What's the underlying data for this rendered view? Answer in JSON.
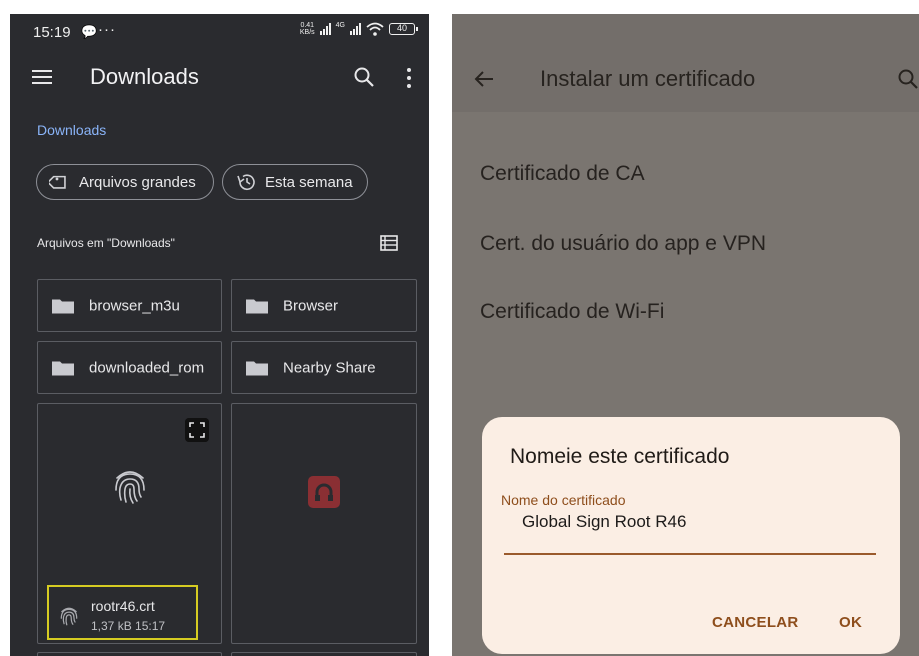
{
  "left": {
    "status": {
      "time": "15:19",
      "more": "···",
      "speed_value": "0.41",
      "speed_unit": "KB/s",
      "network": "4G",
      "battery": "40"
    },
    "appbar": {
      "title": "Downloads"
    },
    "breadcrumb": "Downloads",
    "chips": [
      {
        "label": "Arquivos grandes",
        "icon": "tag-icon"
      },
      {
        "label": "Esta semana",
        "icon": "history-icon"
      }
    ],
    "section_title": "Arquivos em \"Downloads\"",
    "folders": [
      {
        "name": "browser_m3u"
      },
      {
        "name": "Browser"
      },
      {
        "name": "downloaded_rom"
      },
      {
        "name": "Nearby Share"
      }
    ],
    "file": {
      "name": "rootr46.crt",
      "meta": "1,37 kB 15:17"
    }
  },
  "right": {
    "title": "Instalar um certificado",
    "options": [
      "Certificado de CA",
      "Cert. do usuário do app e VPN",
      "Certificado de Wi-Fi"
    ],
    "dialog": {
      "title": "Nomeie este certificado",
      "field_label": "Nome do certificado",
      "field_value": "Global Sign Root R46",
      "cancel": "CANCELAR",
      "ok": "OK"
    }
  },
  "colors": {
    "files_bg": "#2a2b2f",
    "link_blue": "#8ab4f8",
    "highlight_yellow": "#d6cc22",
    "dialog_bg": "#fbeee4",
    "accent_brown": "#8e4e1c"
  }
}
